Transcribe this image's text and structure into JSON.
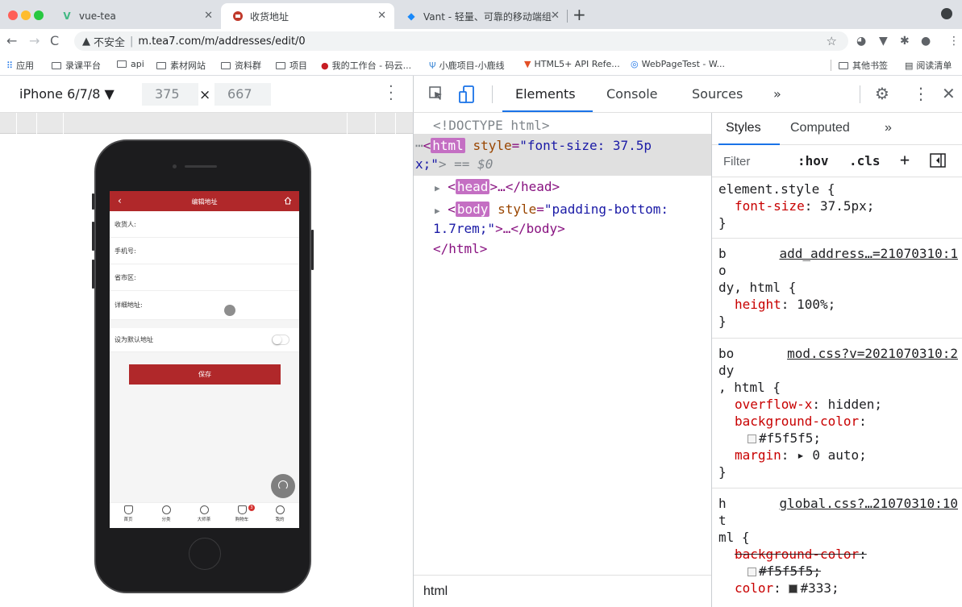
{
  "browser": {
    "tabs": [
      {
        "label": "vue-tea",
        "active": false
      },
      {
        "label": "收货地址",
        "active": true
      },
      {
        "label": "Vant - 轻量、可靠的移动端组件",
        "active": false
      }
    ],
    "new_tab_symbol": "+",
    "address": {
      "security_label": "不安全",
      "url": "m.tea7.com/m/addresses/edit/0"
    },
    "bookmarks": [
      {
        "label": "应用",
        "icon": "apps-grid-icon"
      },
      {
        "label": "录课平台",
        "icon": "folder-icon"
      },
      {
        "label": "api",
        "icon": "folder-icon"
      },
      {
        "label": "素材网站",
        "icon": "folder-icon"
      },
      {
        "label": "资料群",
        "icon": "folder-icon"
      },
      {
        "label": "项目",
        "icon": "folder-icon"
      },
      {
        "label": "我的工作台 - 码云...",
        "icon": "gitee-icon"
      },
      {
        "label": "小鹿项目-小鹿线",
        "icon": "deer-icon"
      },
      {
        "label": "HTML5+ API Refe...",
        "icon": "html5-icon"
      },
      {
        "label": "WebPageTest - W...",
        "icon": "webpagetest-icon"
      }
    ],
    "bookmarks_right": [
      {
        "label": "其他书签",
        "icon": "folder-icon"
      },
      {
        "label": "阅读清单",
        "icon": "reading-list-icon"
      }
    ]
  },
  "device_toolbar": {
    "device": "iPhone 6/7/8 ▼",
    "width": "375",
    "times": "×",
    "height": "667"
  },
  "mobile": {
    "header_title": "编辑地址",
    "back_symbol": "‹",
    "fields": [
      {
        "label": "收货人:"
      },
      {
        "label": "手机号:"
      },
      {
        "label": "省市区:"
      },
      {
        "label": "详细地址:"
      }
    ],
    "default_label": "设为默认地址",
    "save_label": "保存",
    "cart_badge": "3",
    "tabbar": [
      {
        "label": "首页"
      },
      {
        "label": "分类"
      },
      {
        "label": "大师茶"
      },
      {
        "label": "购物车"
      },
      {
        "label": "我的"
      }
    ],
    "accent_color": "#b0282a"
  },
  "devtools": {
    "tabs": [
      "Elements",
      "Console",
      "Sources",
      "»"
    ],
    "active_tab": "Elements",
    "elements": {
      "doctype": "<!DOCTYPE html>",
      "html_prefix": "⋯",
      "html_tag": "html",
      "html_attr": "style",
      "html_value_1": "\"font-size: 37.5p",
      "html_value_2": "x;\"",
      "html_suffix": "> == $0",
      "head_tag": "head",
      "head_rest": ">…</head>",
      "body_tag": "body",
      "body_attr": "style",
      "body_value_1": "\"padding-bottom:",
      "body_value_2": "1.7rem;\"",
      "body_rest": ">…</body>",
      "html_close": "</html>",
      "breadcrumb": "html"
    },
    "styles": {
      "tabs": [
        "Styles",
        "Computed",
        "»"
      ],
      "filter_placeholder": "Filter",
      "hov": ":hov",
      "cls": ".cls",
      "plus": "+",
      "rules": [
        {
          "selector_lines": [
            "element.style {"
          ],
          "source": "",
          "props": [
            {
              "name": "font-size",
              "value": "37.5px;",
              "struck": false
            }
          ]
        },
        {
          "selector_lines": [
            "b",
            "o",
            "dy, html {"
          ],
          "source": "add_address…=21070310:1",
          "props": [
            {
              "name": "height",
              "value": "100%;",
              "struck": false
            }
          ]
        },
        {
          "selector_lines": [
            "bo",
            "dy",
            ", html {"
          ],
          "source": "mod.css?v=2021070310:2",
          "props": [
            {
              "name": "overflow-x",
              "value": "hidden;",
              "struck": false
            },
            {
              "name": "background-color",
              "value": "#f5f5f5;",
              "struck": false
            },
            {
              "name": "margin",
              "value": "▸ 0 auto;",
              "struck": false
            }
          ]
        },
        {
          "selector_lines": [
            "h",
            "t",
            "ml {"
          ],
          "source": "global.css?…21070310:10",
          "props": [
            {
              "name": "background-color",
              "value": "#f5f5f5;",
              "struck": true
            },
            {
              "name": "color",
              "value": "#333;",
              "struck": false
            }
          ]
        }
      ]
    }
  }
}
